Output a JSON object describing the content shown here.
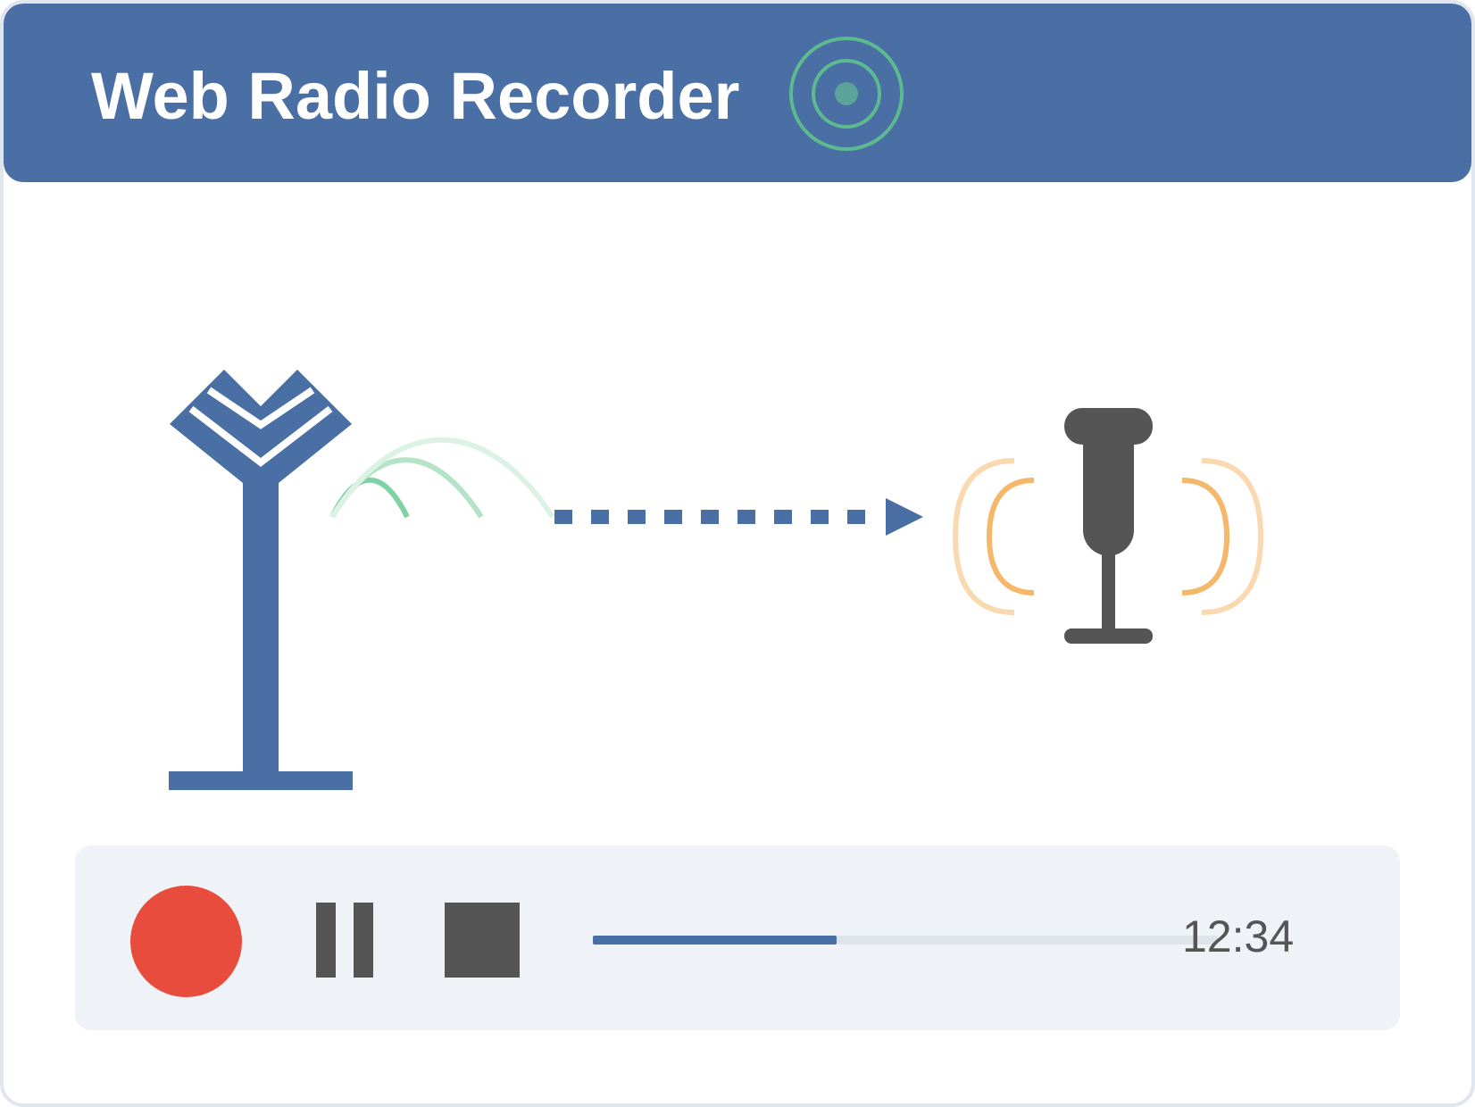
{
  "app": {
    "title": "Web Radio Recorder"
  },
  "icons": {
    "header": "broadcast-target-icon",
    "antenna": "radio-antenna-icon",
    "signal_waves": "signal-waves-icon",
    "flow_arrow": "dotted-arrow-icon",
    "microphone": "microphone-icon",
    "sound_waves": "sound-waves-icon"
  },
  "controls": {
    "record_icon": "record-icon",
    "pause_icon": "pause-icon",
    "stop_icon": "stop-icon",
    "progress_fraction": 0.39,
    "time": "12:34"
  },
  "colors": {
    "header": "#4a6fa5",
    "accent_green": "#5dba8f",
    "record": "#e74c3c",
    "mic": "#555555",
    "sound_wave": "#f5b76a",
    "controls_bg": "#eff2f7"
  }
}
